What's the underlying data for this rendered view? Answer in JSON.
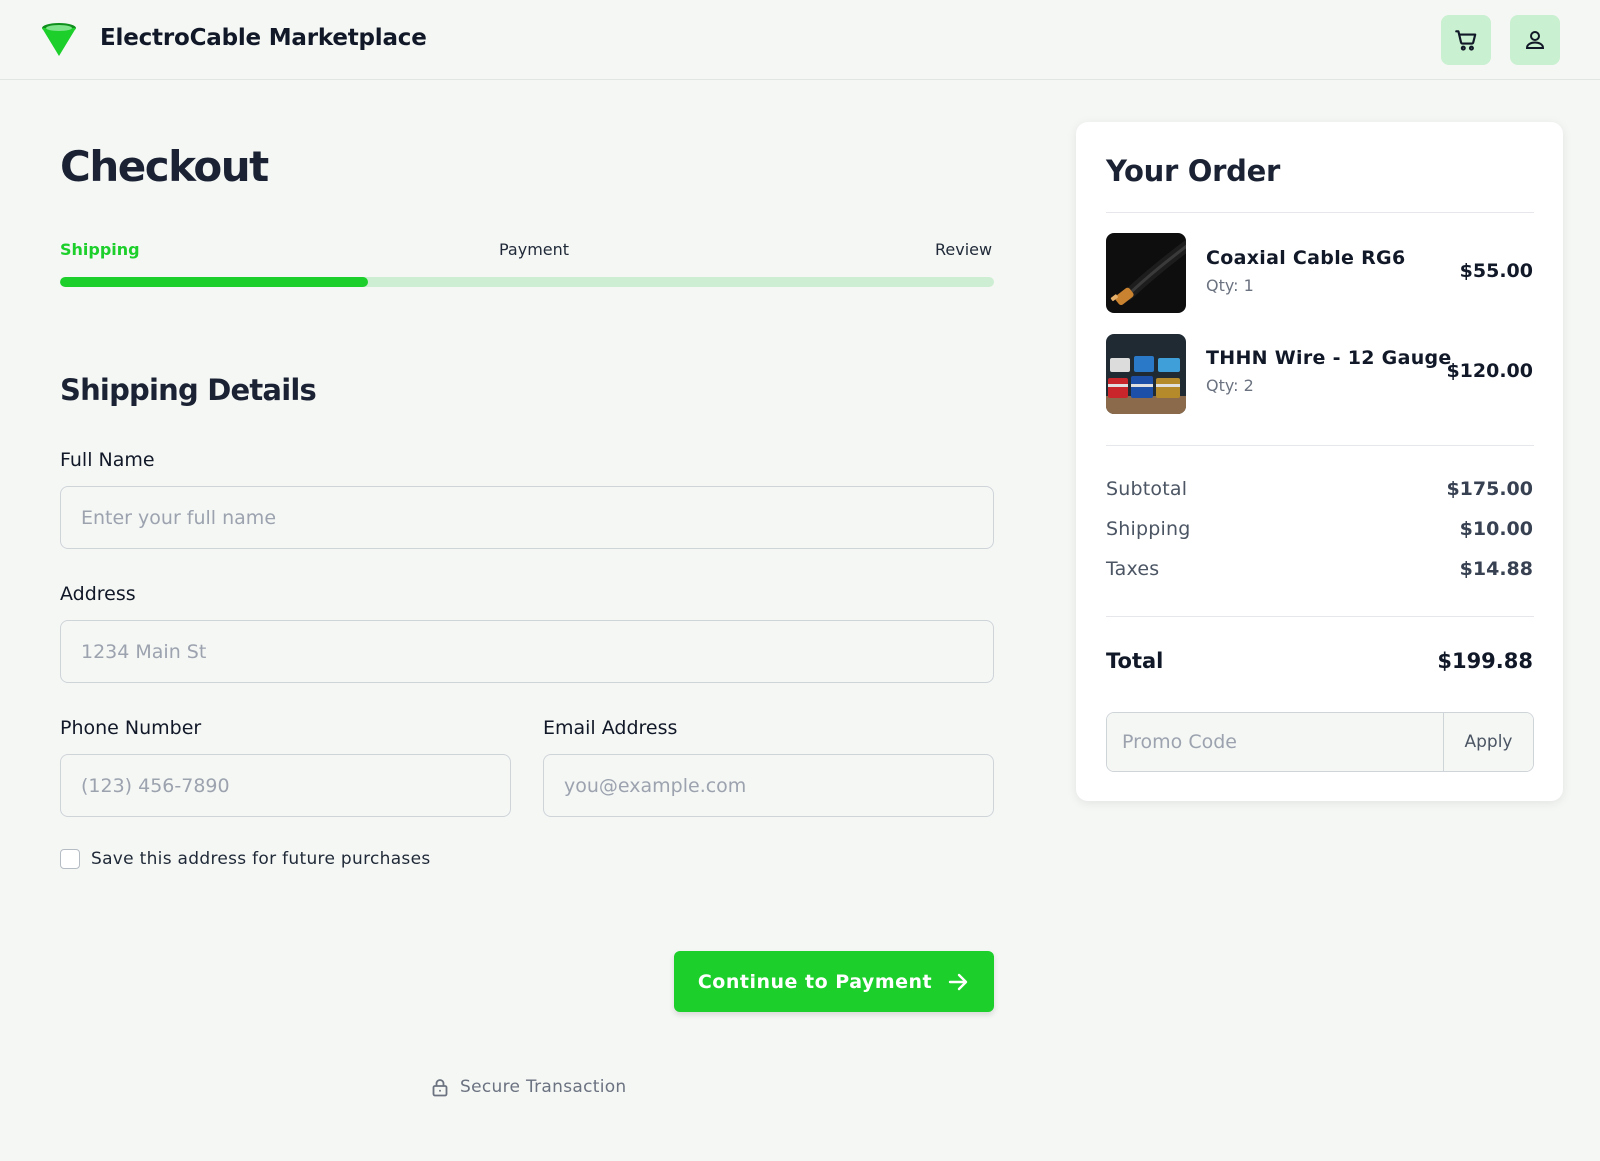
{
  "header": {
    "brand": "ElectroCable Marketplace",
    "logo_icon": "funnel-logo-icon",
    "cart_icon": "cart-icon",
    "user_icon": "user-icon"
  },
  "colors": {
    "accent": "#1ccf2a",
    "accent_light": "#cdeed2",
    "header_button_bg": "#c9f0d0",
    "background": "#f5f7f5"
  },
  "checkout": {
    "title": "Checkout",
    "steps": [
      {
        "label": "Shipping",
        "active": true
      },
      {
        "label": "Payment",
        "active": false
      },
      {
        "label": "Review",
        "active": false
      }
    ],
    "progress_fraction": 0.33
  },
  "shipping": {
    "section_title": "Shipping Details",
    "full_name": {
      "label": "Full Name",
      "placeholder": "Enter your full name",
      "value": ""
    },
    "address": {
      "label": "Address",
      "placeholder": "1234 Main St",
      "value": ""
    },
    "phone": {
      "label": "Phone Number",
      "placeholder": "(123) 456-7890",
      "value": ""
    },
    "email": {
      "label": "Email Address",
      "placeholder": "you@example.com",
      "value": ""
    },
    "save_address": {
      "label": "Save this address for future purchases",
      "checked": false
    },
    "continue_label": "Continue to Payment",
    "secure_label": "Secure Transaction"
  },
  "order": {
    "title": "Your Order",
    "items": [
      {
        "name": "Coaxial Cable RG6",
        "qty": "Qty: 1",
        "price": "$55.00"
      },
      {
        "name": "THHN Wire - 12 Gauge",
        "qty": "Qty: 2",
        "price": "$120.00"
      }
    ],
    "subtotal": {
      "label": "Subtotal",
      "value": "$175.00"
    },
    "shipping": {
      "label": "Shipping",
      "value": "$10.00"
    },
    "taxes": {
      "label": "Taxes",
      "value": "$14.88"
    },
    "total": {
      "label": "Total",
      "value": "$199.88"
    },
    "promo": {
      "placeholder": "Promo Code",
      "apply_label": "Apply"
    }
  }
}
